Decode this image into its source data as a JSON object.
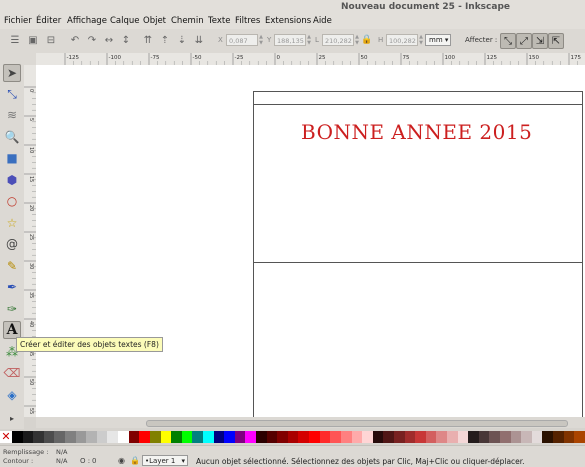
{
  "window": {
    "title": "Nouveau document 25 - Inkscape"
  },
  "menu": [
    "Fichier",
    "Éditer",
    "Affichage",
    "Calque",
    "Objet",
    "Chemin",
    "Texte",
    "Filtres",
    "Extensions",
    "Aide"
  ],
  "toolbar": {
    "x_value": "0,087",
    "y_value": "188,135",
    "w_value": "210,282",
    "h_value": "100,282",
    "unit": "mm",
    "affect_label": "Affecter :"
  },
  "rulers": {
    "h_ticks": [
      "-125",
      "-100",
      "-75",
      "-50",
      "-25",
      "0",
      "25",
      "50",
      "75",
      "100",
      "125",
      "150",
      "175"
    ],
    "v_ticks": [
      "0",
      "5",
      "10",
      "15",
      "20",
      "25",
      "30",
      "35",
      "40",
      "45",
      "50",
      "55"
    ]
  },
  "canvas": {
    "text": "BONNE ANNEE 2015",
    "text_color": "#cc1f1f"
  },
  "tooltip": {
    "text": "Créer et éditer des objets textes (F8)"
  },
  "status": {
    "fill_label": "Remplissage :",
    "fill_value": "N/A",
    "stroke_label": "Contour :",
    "stroke_value": "N/A",
    "opacity_label": "O :",
    "opacity_value": "0",
    "layer": "•Layer 1",
    "message": "Aucun objet sélectionné. Sélectionnez des objets par Clic, Maj+Clic ou cliquer-déplacer."
  },
  "palette": [
    "#000000",
    "#1a1a1a",
    "#333333",
    "#4d4d4d",
    "#666666",
    "#808080",
    "#999999",
    "#b3b3b3",
    "#cccccc",
    "#e6e6e6",
    "#ffffff",
    "#800000",
    "#ff0000",
    "#808000",
    "#ffff00",
    "#008000",
    "#00ff00",
    "#008080",
    "#00ffff",
    "#000080",
    "#0000ff",
    "#800080",
    "#ff00ff",
    "#2b0000",
    "#550000",
    "#800000",
    "#aa0000",
    "#d40000",
    "#ff0000",
    "#ff2a2a",
    "#ff5555",
    "#ff8080",
    "#ffaaaa",
    "#ffd5d5",
    "#280b0b",
    "#501616",
    "#782121",
    "#a02c2c",
    "#c83737",
    "#d35f5f",
    "#de8787",
    "#e9afaf",
    "#f4d7d7",
    "#241c1c",
    "#483737",
    "#6c5353",
    "#916f6f",
    "#ac9393",
    "#c8b7b7",
    "#e3dbdb",
    "#2b1100",
    "#552200",
    "#803300",
    "#aa4400"
  ]
}
